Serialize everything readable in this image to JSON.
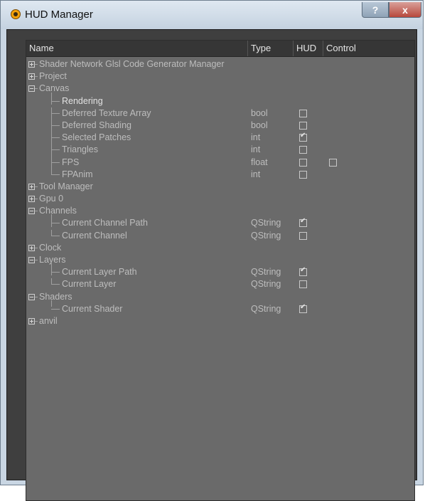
{
  "window": {
    "title": "HUD Manager",
    "help_label": "?",
    "close_label": "x"
  },
  "columns": {
    "name": "Name",
    "type": "Type",
    "hud": "HUD",
    "control": "Control"
  },
  "rows": [
    {
      "name": "Shader Network Glsl Code Generator Manager",
      "type": "",
      "level": 0,
      "expander": "plus"
    },
    {
      "name": "Project",
      "type": "",
      "level": 0,
      "expander": "plus"
    },
    {
      "name": "Canvas",
      "type": "",
      "level": 0,
      "expander": "minus"
    },
    {
      "name": "Rendering",
      "type": "",
      "level": 1
    },
    {
      "name": "Deferred Texture Array",
      "type": "bool",
      "level": 1,
      "hud": false
    },
    {
      "name": "Deferred Shading",
      "type": "bool",
      "level": 1,
      "hud": false
    },
    {
      "name": "Selected Patches",
      "type": "int",
      "level": 1,
      "hud": true
    },
    {
      "name": "Triangles",
      "type": "int",
      "level": 1,
      "hud": false
    },
    {
      "name": "FPS",
      "type": "float",
      "level": 1,
      "hud": false,
      "control": false
    },
    {
      "name": "FPAnim",
      "type": "int",
      "level": 1,
      "hud": false
    },
    {
      "name": "Tool Manager",
      "type": "",
      "level": 0,
      "expander": "plus"
    },
    {
      "name": "Gpu 0",
      "type": "",
      "level": 0,
      "expander": "plus"
    },
    {
      "name": "Channels",
      "type": "",
      "level": 0,
      "expander": "minus"
    },
    {
      "name": "Current Channel Path",
      "type": "QString",
      "level": 1,
      "hud": true
    },
    {
      "name": "Current Channel",
      "type": "QString",
      "level": 1,
      "hud": false
    },
    {
      "name": "Clock",
      "type": "",
      "level": 0,
      "expander": "plus"
    },
    {
      "name": "Layers",
      "type": "",
      "level": 0,
      "expander": "minus"
    },
    {
      "name": "Current Layer Path",
      "type": "QString",
      "level": 1,
      "hud": true
    },
    {
      "name": "Current Layer",
      "type": "QString",
      "level": 1,
      "hud": false
    },
    {
      "name": "Shaders",
      "type": "",
      "level": 0,
      "expander": "minus"
    },
    {
      "name": "Current Shader",
      "type": "QString",
      "level": 1,
      "hud": true
    },
    {
      "name": "anvil",
      "type": "",
      "level": 0,
      "expander": "plus"
    }
  ]
}
